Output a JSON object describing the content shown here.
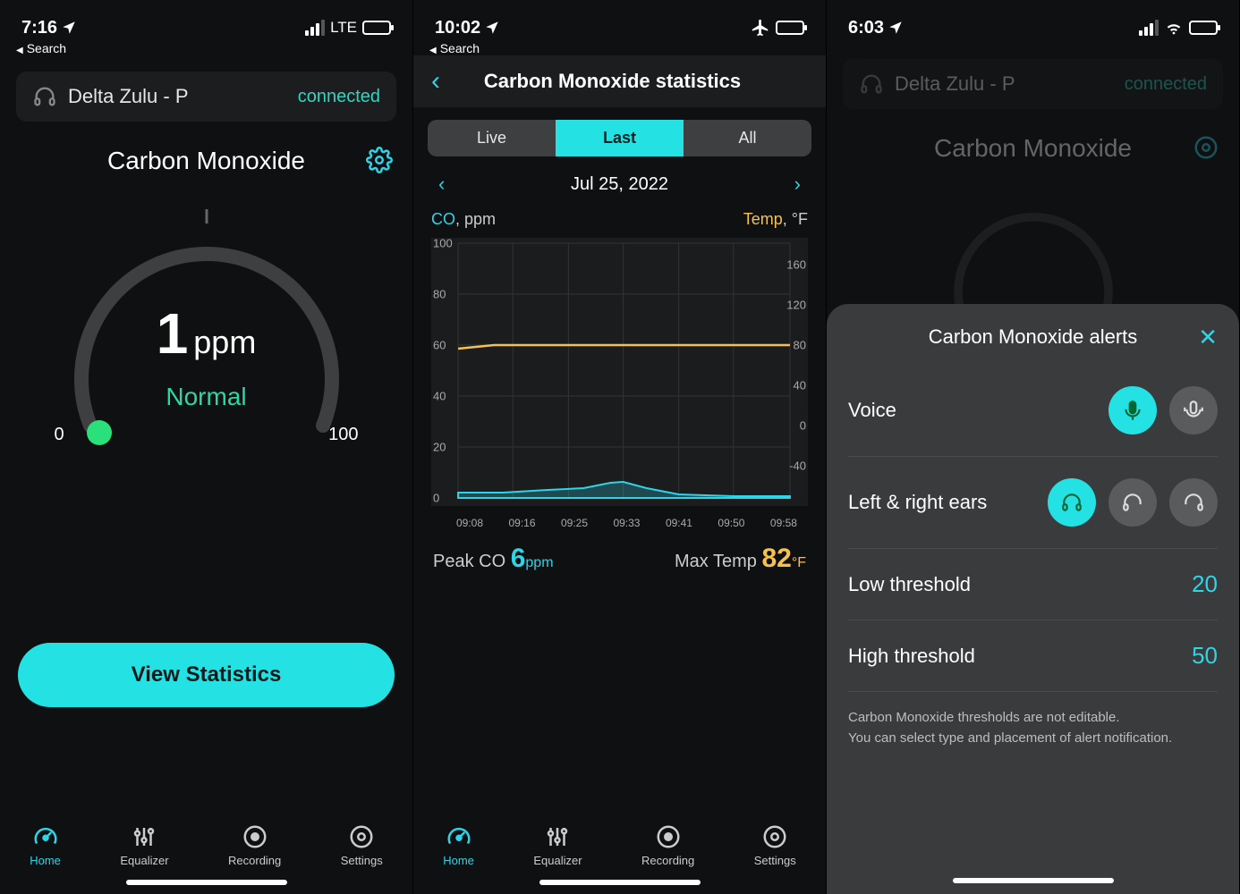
{
  "screen1": {
    "status": {
      "time": "7:16",
      "back": "Search",
      "network": "LTE"
    },
    "device": {
      "name": "Delta Zulu - P",
      "state": "connected"
    },
    "title": "Carbon Monoxide",
    "gauge": {
      "value": "1",
      "unit": "ppm",
      "status": "Normal",
      "min": "0",
      "max": "100"
    },
    "cta": "View Statistics"
  },
  "screen2": {
    "status": {
      "time": "10:02",
      "back": "Search"
    },
    "title": "Carbon Monoxide statistics",
    "segments": {
      "a": "Live",
      "b": "Last",
      "c": "All"
    },
    "date": "Jul 25, 2022",
    "axis": {
      "co": "CO",
      "co_unit": ", ppm",
      "temp": "Temp",
      "temp_unit": ", °F"
    },
    "peak": {
      "label": "Peak CO ",
      "value": "6",
      "unit": "ppm"
    },
    "max": {
      "label": "Max Temp ",
      "value": "82",
      "unit": "°F"
    }
  },
  "screen3": {
    "status": {
      "time": "6:03"
    },
    "device": {
      "name": "Delta Zulu - P",
      "state": "connected"
    },
    "title": "Carbon Monoxide",
    "sheet": {
      "title": "Carbon Monoxide alerts",
      "voice": "Voice",
      "ears": "Left & right ears",
      "low_label": "Low threshold",
      "low_val": "20",
      "high_label": "High threshold",
      "high_val": "50",
      "footer1": "Carbon Monoxide thresholds are not editable.",
      "footer2": "You can select type and placement of alert notification."
    }
  },
  "nav": {
    "home": "Home",
    "eq": "Equalizer",
    "rec": "Recording",
    "set": "Settings"
  },
  "chart_data": {
    "type": "line",
    "title": "Carbon Monoxide statistics — Jul 25, 2022",
    "x_ticks": [
      "09:08",
      "09:16",
      "09:25",
      "09:33",
      "09:41",
      "09:50",
      "09:58"
    ],
    "y_left": {
      "label": "CO, ppm",
      "ticks": [
        0,
        20,
        40,
        60,
        80,
        100
      ],
      "range": [
        0,
        100
      ]
    },
    "y_right": {
      "label": "Temp, °F",
      "ticks": [
        -40,
        0,
        40,
        80,
        120,
        160
      ],
      "range": [
        -80,
        200
      ]
    },
    "series": [
      {
        "name": "CO (ppm)",
        "axis": "left",
        "color": "#2ed4e8",
        "x": [
          "09:08",
          "09:16",
          "09:25",
          "09:33",
          "09:41",
          "09:50",
          "09:58"
        ],
        "y": [
          2,
          2,
          3,
          6,
          3,
          1,
          1
        ]
      },
      {
        "name": "Temp (°F)",
        "axis": "right",
        "color": "#f6c24a",
        "x": [
          "09:08",
          "09:16",
          "09:25",
          "09:33",
          "09:41",
          "09:50",
          "09:58"
        ],
        "y": [
          78,
          80,
          80,
          80,
          80,
          80,
          80
        ]
      }
    ],
    "summary": {
      "peak_co_ppm": 6,
      "max_temp_f": 82
    }
  }
}
